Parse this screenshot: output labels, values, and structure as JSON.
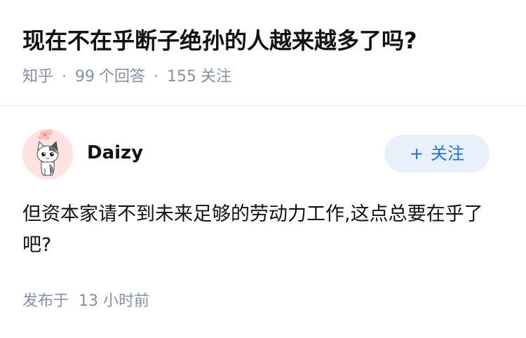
{
  "question": {
    "title": "现在不在乎断子绝孙的人越来越多了吗?",
    "source": "知乎",
    "answer_count": "99",
    "answer_count_label": "个回答",
    "follower_count": "155",
    "follower_label": "关注",
    "separator": "·"
  },
  "answer": {
    "author": {
      "name": "Daizy",
      "avatar_icon": "cat-avatar-icon"
    },
    "follow_button": {
      "plus": "+",
      "label": "关注"
    },
    "content": "但资本家请不到未来足够的劳动力工作,这点总要在乎了吧?",
    "time_label": "发布于",
    "time_value": "13 小时前"
  },
  "colors": {
    "accent": "#1772f6",
    "follow_bg": "#e8f0fb",
    "meta_text": "#8590a6",
    "avatar_bg": "#fde3e1"
  }
}
